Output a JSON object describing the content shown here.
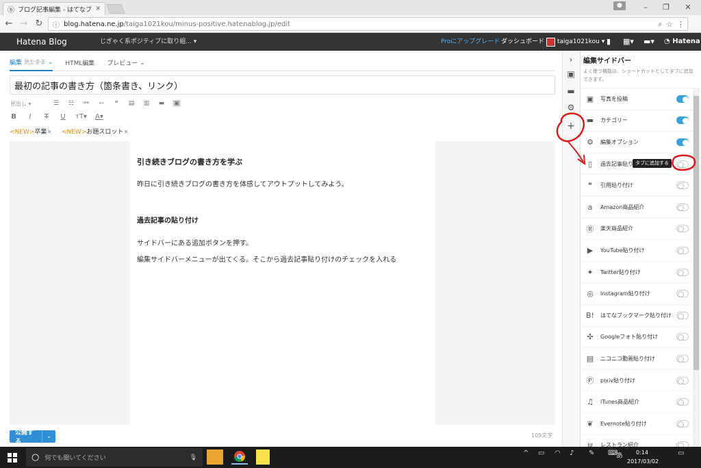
{
  "browser": {
    "tab_title": "ブログ記事編集 - はてなブ...",
    "url_host": "blog.hatena.ne.jp",
    "url_path": "/taiga1021kou/minus-positive.hatenablog.jp/edit"
  },
  "header": {
    "logo": "Hatena Blog",
    "blog_name": "じぎゃく系ポジティブに取り組...",
    "pro_upgrade": "Proにアップグレード",
    "dashboard": "ダッシュボード",
    "account": "taiga1021kou",
    "hatena": "Hatena"
  },
  "editor": {
    "tab_edit": "編集",
    "tab_edit_sub": "見たまま",
    "tab_html": "HTML編集",
    "tab_preview": "プレビュー",
    "title": "最初の記事の書き方（箇条書き、リンク）",
    "format_select": "見出し",
    "tags": [
      {
        "new": "<NEW>",
        "label": "卒業",
        "x": "×"
      },
      {
        "new": "<NEW>",
        "label": "お題スロット",
        "x": "×"
      }
    ],
    "content": {
      "h3": "引き続きブログの書き方を学ぶ",
      "p1": "昨日に引き続きブログの書き方を体感してアウトプットしてみよう。",
      "h4": "過去記事の貼り付け",
      "p2": "サイドバーにある追加ボタンを押す。",
      "p3": "編集サイドバーメニューが出てくる。そこから過去記事貼り付けのチェックを入れる"
    },
    "publish": "公開する",
    "char_count": "109文字"
  },
  "sidebar": {
    "title": "編集サイドバー",
    "description": "よく使う機能は、ショートカットとしてタブに追加できます。",
    "tooltip": "タブに追加する",
    "items": [
      {
        "label": "写真を投稿",
        "icon": "photo-icon",
        "on": true
      },
      {
        "label": "カテゴリー",
        "icon": "folder-icon",
        "on": true
      },
      {
        "label": "編集オプション",
        "icon": "gear-icon",
        "on": true
      },
      {
        "label": "過去記事貼り付け",
        "icon": "document-icon",
        "on": false
      },
      {
        "label": "引用貼り付け",
        "icon": "quote-icon",
        "on": false
      },
      {
        "label": "Amazon商品紹介",
        "icon": "amazon-icon",
        "on": false
      },
      {
        "label": "楽天商品紹介",
        "icon": "rakuten-icon",
        "on": false
      },
      {
        "label": "YouTube貼り付け",
        "icon": "youtube-icon",
        "on": false
      },
      {
        "label": "Twitter貼り付け",
        "icon": "twitter-icon",
        "on": false
      },
      {
        "label": "Instagram貼り付け",
        "icon": "instagram-icon",
        "on": false
      },
      {
        "label": "はてなブックマーク貼り付け",
        "icon": "hatebu-icon",
        "on": false
      },
      {
        "label": "Googleフォト貼り付け",
        "icon": "pinwheel-icon",
        "on": false
      },
      {
        "label": "ニコニコ動画貼り付け",
        "icon": "tv-icon",
        "on": false
      },
      {
        "label": "pixiv貼り付け",
        "icon": "pixiv-icon",
        "on": false
      },
      {
        "label": "iTunes商品紹介",
        "icon": "music-icon",
        "on": false
      },
      {
        "label": "Evernote貼り付け",
        "icon": "evernote-icon",
        "on": false
      },
      {
        "label": "レストラン紹介",
        "icon": "fork-icon",
        "on": false
      }
    ]
  },
  "taskbar": {
    "search_placeholder": "何でも聞いてください",
    "ime": "あ",
    "time": "0:14",
    "date": "2017/03/02"
  },
  "colors": {
    "accent": "#2f8ed6",
    "toggle_on": "#3aa0dc",
    "annotation": "#e0191e",
    "header_bg": "#333333"
  }
}
